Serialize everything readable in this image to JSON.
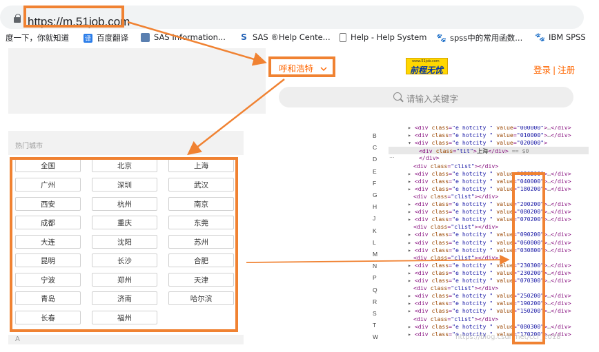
{
  "browser": {
    "url": "https://m.51job.com",
    "bookmarks": [
      {
        "label": "度一下，你就知道",
        "icon": "none"
      },
      {
        "label": "百度翻译",
        "icon": "translate-icon"
      },
      {
        "label": "SAS Information...",
        "icon": "sas-icon"
      },
      {
        "label": "SAS ®Help Cente...",
        "icon": "sas-s-icon"
      },
      {
        "label": "Help - Help System",
        "icon": "page-icon"
      },
      {
        "label": "spss中的常用函数...",
        "icon": "paw-icon"
      },
      {
        "label": "IBM SPSS",
        "icon": "paw-icon"
      }
    ]
  },
  "mobile_page": {
    "city_selector": "呼和浩特",
    "logo_top": "www.51job.com",
    "logo_main": "前程无忧",
    "login": "登录",
    "register": "注册",
    "search_placeholder": "请输入关键字",
    "hot_cities_title": "热门城市",
    "hot_cities": [
      "全国",
      "北京",
      "上海",
      "广州",
      "深圳",
      "武汉",
      "西安",
      "杭州",
      "南京",
      "成都",
      "重庆",
      "东莞",
      "大连",
      "沈阳",
      "苏州",
      "昆明",
      "长沙",
      "合肥",
      "宁波",
      "郑州",
      "天津",
      "青岛",
      "济南",
      "哈尔滨",
      "长春",
      "福州"
    ],
    "alpha_section": "A"
  },
  "devtools": {
    "index_letters": [
      "B",
      "C",
      "D",
      "E",
      "F",
      "G",
      "H",
      "J",
      "K",
      "L",
      "M",
      "N",
      "P",
      "Q",
      "R",
      "S",
      "T",
      "W"
    ],
    "selected_marker": "...",
    "lines": [
      {
        "tri": "▸",
        "type": "hot",
        "value": "000000",
        "indent": 1
      },
      {
        "tri": "▸",
        "type": "hot",
        "value": "010000",
        "indent": 1
      },
      {
        "tri": "▾",
        "type": "hot-open",
        "value": "020000",
        "indent": 1
      },
      {
        "tri": "",
        "type": "tit",
        "text": "上海",
        "eq": " == $0",
        "indent": 2,
        "selected": true
      },
      {
        "tri": "",
        "type": "close",
        "indent": 2
      },
      {
        "tri": "",
        "type": "clist",
        "indent": 1
      },
      {
        "tri": "▸",
        "type": "hot",
        "value": "030200",
        "indent": 1
      },
      {
        "tri": "▸",
        "type": "hot",
        "value": "040000",
        "indent": 1
      },
      {
        "tri": "▸",
        "type": "hot",
        "value": "180200",
        "indent": 1
      },
      {
        "tri": "",
        "type": "clist",
        "indent": 1
      },
      {
        "tri": "▸",
        "type": "hot",
        "value": "200200",
        "indent": 1
      },
      {
        "tri": "▸",
        "type": "hot",
        "value": "080200",
        "indent": 1
      },
      {
        "tri": "▸",
        "type": "hot",
        "value": "070200",
        "indent": 1
      },
      {
        "tri": "",
        "type": "clist",
        "indent": 1
      },
      {
        "tri": "▸",
        "type": "hot",
        "value": "090200",
        "indent": 1
      },
      {
        "tri": "▸",
        "type": "hot",
        "value": "060000",
        "indent": 1
      },
      {
        "tri": "▸",
        "type": "hot",
        "value": "030800",
        "indent": 1
      },
      {
        "tri": "",
        "type": "clist",
        "indent": 1
      },
      {
        "tri": "▸",
        "type": "hot",
        "value": "230300",
        "indent": 1
      },
      {
        "tri": "▸",
        "type": "hot",
        "value": "230200",
        "indent": 1
      },
      {
        "tri": "▸",
        "type": "hot",
        "value": "070300",
        "indent": 1
      },
      {
        "tri": "",
        "type": "clist",
        "indent": 1
      },
      {
        "tri": "▸",
        "type": "hot",
        "value": "250200",
        "indent": 1
      },
      {
        "tri": "▸",
        "type": "hot",
        "value": "190200",
        "indent": 1
      },
      {
        "tri": "▸",
        "type": "hot",
        "value": "150200",
        "indent": 1
      },
      {
        "tri": "",
        "type": "clist",
        "indent": 1
      },
      {
        "tri": "▸",
        "type": "hot",
        "value": "080300",
        "indent": 1
      },
      {
        "tri": "▸",
        "type": "hot",
        "value": "170200",
        "indent": 1
      }
    ]
  },
  "watermark": "https://blog.csdn.net/ccr_2018",
  "colors": {
    "accent": "#f08232",
    "brand_orange": "#ff6600",
    "logo_yellow": "#ffd700"
  }
}
